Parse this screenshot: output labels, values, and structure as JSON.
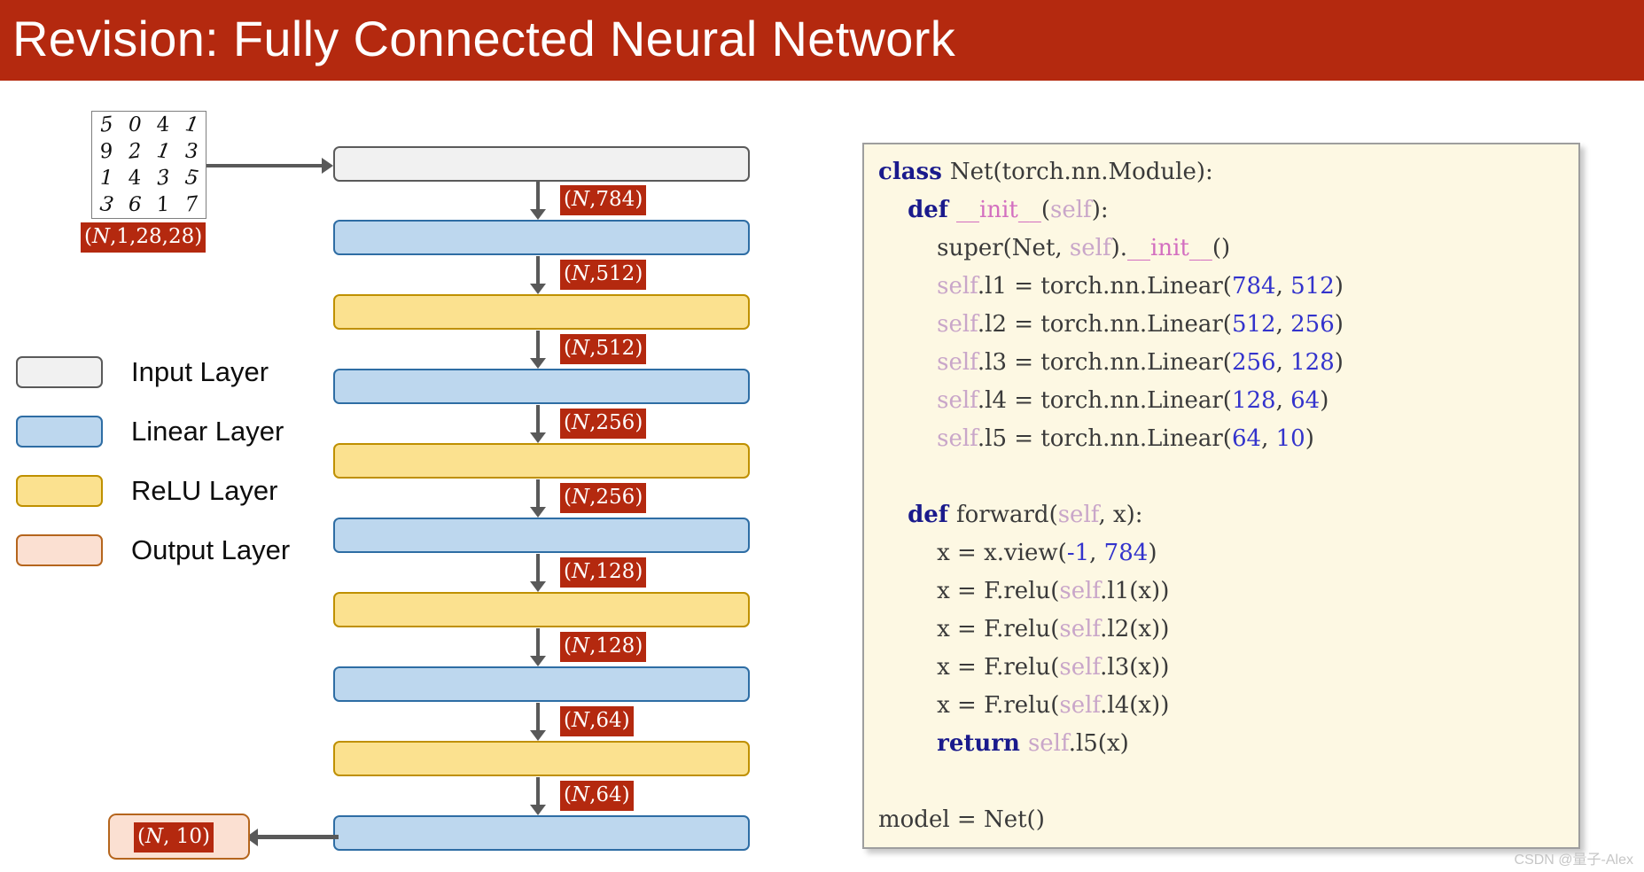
{
  "slide": {
    "title": "Revision: Fully Connected Neural Network",
    "banner_color": "#b4290f",
    "watermark": "CSDN @量子-Alex"
  },
  "mnist": {
    "alt": "mnist-digit-grid",
    "digits": [
      "5",
      "0",
      "4",
      "1",
      "9",
      "2",
      "1",
      "3",
      "1",
      "4",
      "3",
      "5",
      "3",
      "6",
      "1",
      "7"
    ],
    "input_shape": "(N,1,28,28)"
  },
  "legend": {
    "items": [
      {
        "label": "Input Layer",
        "color": "#f1f1f1",
        "border": "#5a5a5a"
      },
      {
        "label": "Linear Layer",
        "color": "#bdd7ee",
        "border": "#2e6da4"
      },
      {
        "label": "ReLU Layer",
        "color": "#fbe18f",
        "border": "#bf9000"
      },
      {
        "label": "Output Layer",
        "color": "#fbe0d2",
        "border": "#b5651d"
      }
    ]
  },
  "diagram": {
    "layers": [
      {
        "name": "input",
        "type": "Input Layer"
      },
      {
        "name": "linear1",
        "type": "Linear Layer"
      },
      {
        "name": "relu1",
        "type": "ReLU Layer"
      },
      {
        "name": "linear2",
        "type": "Linear Layer"
      },
      {
        "name": "relu2",
        "type": "ReLU Layer"
      },
      {
        "name": "linear3",
        "type": "Linear Layer"
      },
      {
        "name": "relu3",
        "type": "ReLU Layer"
      },
      {
        "name": "linear4",
        "type": "Linear Layer"
      },
      {
        "name": "relu4",
        "type": "ReLU Layer"
      },
      {
        "name": "linear5",
        "type": "Linear Layer"
      }
    ],
    "shape_tags": [
      "(N,784)",
      "(N,512)",
      "(N,512)",
      "(N,256)",
      "(N,256)",
      "(N,128)",
      "(N,128)",
      "(N,64)",
      "(N,64)"
    ],
    "output_shape": "(N, 10)"
  },
  "code": {
    "lines": [
      [
        {
          "t": "class ",
          "c": "kw"
        },
        {
          "t": "Net(torch.nn.Module):",
          "c": "plain"
        }
      ],
      [
        {
          "t": "    ",
          "c": "plain"
        },
        {
          "t": "def ",
          "c": "kw"
        },
        {
          "t": "__init__",
          "c": "dunder"
        },
        {
          "t": "(",
          "c": "plain"
        },
        {
          "t": "self",
          "c": "selfk"
        },
        {
          "t": "):",
          "c": "plain"
        }
      ],
      [
        {
          "t": "        super(Net, ",
          "c": "plain"
        },
        {
          "t": "self",
          "c": "selfk"
        },
        {
          "t": ").",
          "c": "plain"
        },
        {
          "t": "__init__",
          "c": "dunder"
        },
        {
          "t": "()",
          "c": "plain"
        }
      ],
      [
        {
          "t": "        ",
          "c": "plain"
        },
        {
          "t": "self",
          "c": "selfk"
        },
        {
          "t": ".l1 = torch.nn.Linear(",
          "c": "plain"
        },
        {
          "t": "784",
          "c": "num"
        },
        {
          "t": ", ",
          "c": "plain"
        },
        {
          "t": "512",
          "c": "num"
        },
        {
          "t": ")",
          "c": "plain"
        }
      ],
      [
        {
          "t": "        ",
          "c": "plain"
        },
        {
          "t": "self",
          "c": "selfk"
        },
        {
          "t": ".l2 = torch.nn.Linear(",
          "c": "plain"
        },
        {
          "t": "512",
          "c": "num"
        },
        {
          "t": ", ",
          "c": "plain"
        },
        {
          "t": "256",
          "c": "num"
        },
        {
          "t": ")",
          "c": "plain"
        }
      ],
      [
        {
          "t": "        ",
          "c": "plain"
        },
        {
          "t": "self",
          "c": "selfk"
        },
        {
          "t": ".l3 = torch.nn.Linear(",
          "c": "plain"
        },
        {
          "t": "256",
          "c": "num"
        },
        {
          "t": ", ",
          "c": "plain"
        },
        {
          "t": "128",
          "c": "num"
        },
        {
          "t": ")",
          "c": "plain"
        }
      ],
      [
        {
          "t": "        ",
          "c": "plain"
        },
        {
          "t": "self",
          "c": "selfk"
        },
        {
          "t": ".l4 = torch.nn.Linear(",
          "c": "plain"
        },
        {
          "t": "128",
          "c": "num"
        },
        {
          "t": ", ",
          "c": "plain"
        },
        {
          "t": "64",
          "c": "num"
        },
        {
          "t": ")",
          "c": "plain"
        }
      ],
      [
        {
          "t": "        ",
          "c": "plain"
        },
        {
          "t": "self",
          "c": "selfk"
        },
        {
          "t": ".l5 = torch.nn.Linear(",
          "c": "plain"
        },
        {
          "t": "64",
          "c": "num"
        },
        {
          "t": ", ",
          "c": "plain"
        },
        {
          "t": "10",
          "c": "num"
        },
        {
          "t": ")",
          "c": "plain"
        }
      ],
      [
        {
          "t": " ",
          "c": "plain"
        }
      ],
      [
        {
          "t": "    ",
          "c": "plain"
        },
        {
          "t": "def ",
          "c": "kw"
        },
        {
          "t": "forward(",
          "c": "plain"
        },
        {
          "t": "self",
          "c": "selfk"
        },
        {
          "t": ", x):",
          "c": "plain"
        }
      ],
      [
        {
          "t": "        x = x.view(",
          "c": "plain"
        },
        {
          "t": "-1",
          "c": "num"
        },
        {
          "t": ", ",
          "c": "plain"
        },
        {
          "t": "784",
          "c": "num"
        },
        {
          "t": ")",
          "c": "plain"
        }
      ],
      [
        {
          "t": "        x = F.relu(",
          "c": "plain"
        },
        {
          "t": "self",
          "c": "selfk"
        },
        {
          "t": ".l1(x))",
          "c": "plain"
        }
      ],
      [
        {
          "t": "        x = F.relu(",
          "c": "plain"
        },
        {
          "t": "self",
          "c": "selfk"
        },
        {
          "t": ".l2(x))",
          "c": "plain"
        }
      ],
      [
        {
          "t": "        x = F.relu(",
          "c": "plain"
        },
        {
          "t": "self",
          "c": "selfk"
        },
        {
          "t": ".l3(x))",
          "c": "plain"
        }
      ],
      [
        {
          "t": "        x = F.relu(",
          "c": "plain"
        },
        {
          "t": "self",
          "c": "selfk"
        },
        {
          "t": ".l4(x))",
          "c": "plain"
        }
      ],
      [
        {
          "t": "        ",
          "c": "plain"
        },
        {
          "t": "return ",
          "c": "kw"
        },
        {
          "t": "self",
          "c": "selfk"
        },
        {
          "t": ".l5(x)",
          "c": "plain"
        }
      ],
      [
        {
          "t": " ",
          "c": "plain"
        }
      ],
      [
        {
          "t": "model = Net()",
          "c": "plain"
        }
      ]
    ]
  }
}
